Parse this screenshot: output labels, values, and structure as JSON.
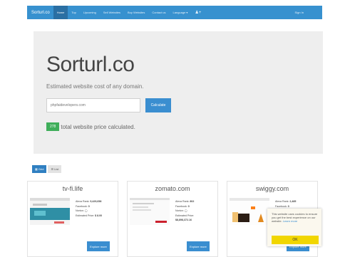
{
  "navbar": {
    "brand": "Sorturl.co",
    "items": [
      {
        "label": "Home",
        "active": true
      },
      {
        "label": "Top",
        "active": false
      },
      {
        "label": "Upcoming",
        "active": false
      },
      {
        "label": "Sell Websites",
        "active": false
      },
      {
        "label": "Buy Websites",
        "active": false
      },
      {
        "label": "Contact us",
        "active": false
      },
      {
        "label": "Language ▾",
        "active": false
      }
    ],
    "sign_in": "Sign In"
  },
  "hero": {
    "title": "Sorturl.co",
    "subtitle": "Estimated website cost of any domain.",
    "search": {
      "placeholder": "phpfaidevelopers.com",
      "value": ""
    },
    "button": "Calculate",
    "count_badge": "278",
    "count_text": "total website price calculated."
  },
  "view_toggle": {
    "grid": "Grid",
    "list": "List"
  },
  "stat_labels": [
    "Alexa Rank:",
    "Facebook:",
    "Norton:",
    "Estimated Price:"
  ],
  "cards": [
    {
      "domain": "tv-fi.life",
      "alexa": "9,429,658",
      "facebook": "0",
      "estimated": "$ 8.00",
      "button": "Explore more"
    },
    {
      "domain": "zomato.com",
      "alexa": "802",
      "facebook": "0",
      "estimated": "$8,898,372.16",
      "button": "Explore more"
    },
    {
      "domain": "swiggy.com",
      "alexa": "2,485",
      "facebook": "0",
      "estimated": "",
      "button": "Explore more"
    }
  ],
  "cookie": {
    "text": "This website uses cookies to ensure you get the best experience on our website.",
    "link": "Learn more",
    "button": "OK"
  },
  "colors": {
    "navbar": "#3791cf",
    "navbar_active": "#2a6fa3",
    "primary_button": "#3a8ed0",
    "success_badge": "#3fae5a",
    "cookie_button": "#f1d600"
  }
}
